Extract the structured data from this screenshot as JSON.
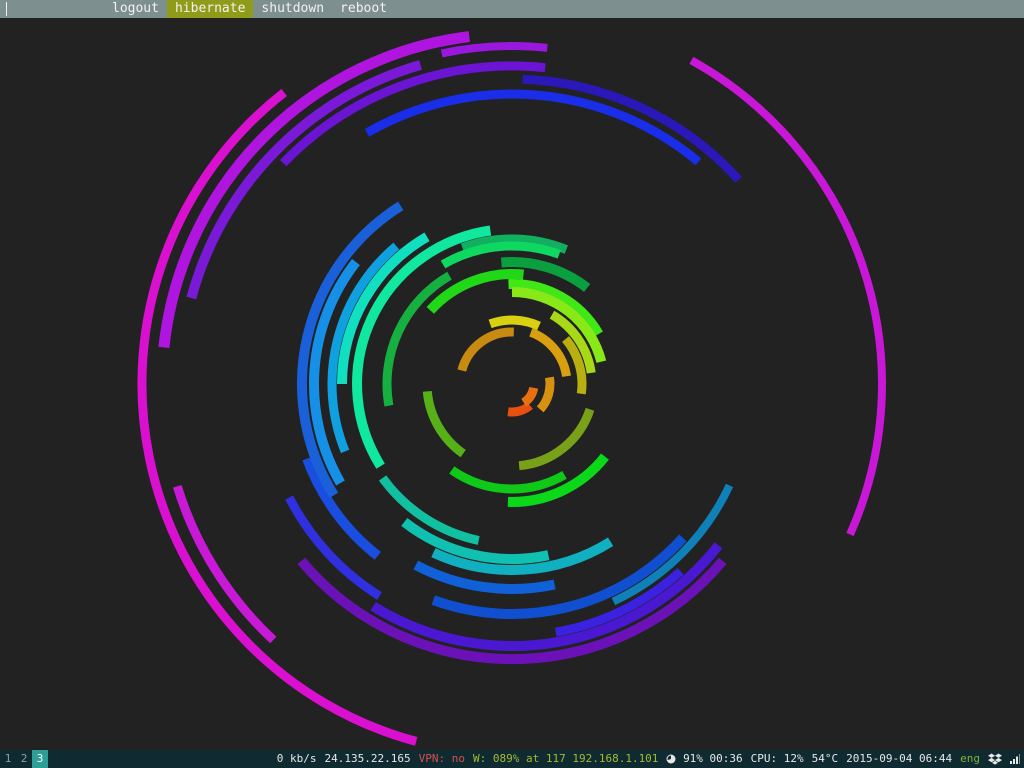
{
  "topbar": {
    "items": [
      {
        "label": "logout",
        "active": false
      },
      {
        "label": "hibernate",
        "active": true
      },
      {
        "label": "shutdown",
        "active": false
      },
      {
        "label": "reboot",
        "active": false
      }
    ]
  },
  "statusbar": {
    "workspaces": [
      "1",
      "2",
      "3"
    ],
    "active_workspace": "3",
    "net_speed": "0 kb/s",
    "public_ip": "24.135.22.165",
    "vpn": "VPN: no",
    "wifi": "W: 089% at 117 192.168.1.101",
    "battery": "91% 00:36",
    "cpu": "CPU: 12%",
    "temp": "54°C",
    "datetime": "2015-09-04 06:44",
    "layout": "eng",
    "icons": [
      "battery-icon",
      "dropbox-icon",
      "signal-icon"
    ]
  },
  "colors": {
    "background": "#222222",
    "topbar": "#7e8f90",
    "topbar_active": "#8f9c1a",
    "statusbar": "#0f2a30",
    "workspace_active": "#2e9f96",
    "vpn": "#d8504e",
    "wifi": "#a7b933",
    "lang": "#7fb33a"
  }
}
